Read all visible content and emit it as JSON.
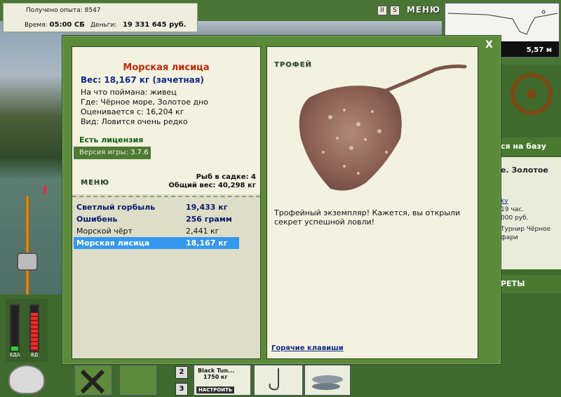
{
  "hud": {
    "xp_label": "Получено опыта:",
    "xp_value": "8547",
    "time_label": "Время:",
    "time_value": "05:00 СБ",
    "money_label": "Деньги:",
    "money_value": "19 331 645 руб.",
    "pause_label": "II",
    "sound_label": "S",
    "menu_label": "МЕНЮ",
    "depth_value": "5,57 м"
  },
  "dialog": {
    "close_label": "X",
    "fish_name": "Морская лисица",
    "fish_weight": "Вес: 18,167 кг (зачетная)",
    "details": [
      "На что поймана: живец",
      "Где: Чёрное море, Золотое дно",
      "Оценивается с: 16,204 кг",
      "Вид: Ловится очень редко"
    ],
    "license": "Есть лицензия",
    "version_label": "Версия игры:",
    "version_value": "3.7.6",
    "menu_label": "МЕНЮ",
    "keepnet_count": "Рыб в садке: 4",
    "keepnet_total": "Общий вес: 40,298 кг",
    "catch": [
      {
        "name": "Светлый горбыль",
        "weight": "19,433 кг",
        "style": "bold"
      },
      {
        "name": "Ошибень",
        "weight": "256 грамм",
        "style": "bold"
      },
      {
        "name": "Морской чёрт",
        "weight": "2,441 кг",
        "style": "normal"
      },
      {
        "name": "Морская лисица",
        "weight": "18,167 кг",
        "style": "selected"
      }
    ],
    "trophy_label": "ТРОФЕЙ",
    "trophy_text": "Трофейный экземпляр! Кажется, вы открыли секрет успешной ловли!",
    "hotkeys_label": "Горячие клавиши"
  },
  "side": {
    "base_label": "ся на базу",
    "place_label": "е. Золотое",
    "info_lines": [
      "kv",
      "19 час.",
      "000 руб.",
      "Турнир Чёрное",
      "фари"
    ],
    "secrets_label": "РЕТЫ",
    "marks": [
      "x",
      "x",
      "x",
      "x",
      "x"
    ],
    "bottom_mark": "3 x"
  },
  "bottom": {
    "food_label": "ЕДА",
    "water_label": "ВД",
    "slot2": "2",
    "slot3": "3",
    "lure_name": "Black Tun...",
    "lure_weight": "1750 кг",
    "setup_label": "НАСТРОИТЬ"
  }
}
